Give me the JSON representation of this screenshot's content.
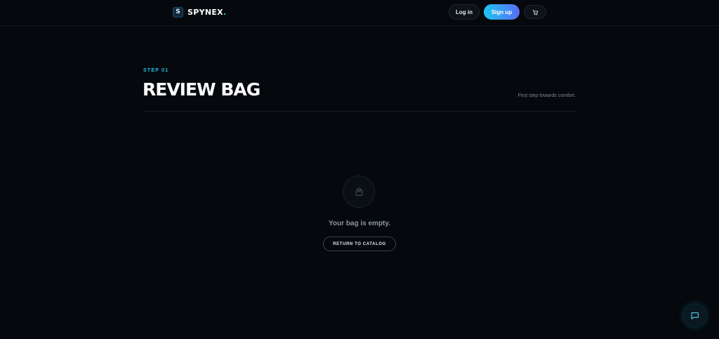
{
  "header": {
    "logo_mark": "S",
    "logo_name": "SPYNEX",
    "logo_dot": ".",
    "login_label": "Log in",
    "signup_label": "Sign up",
    "cart_icon": "cart-icon"
  },
  "main": {
    "step_label": "STEP 01",
    "title": "REVIEW BAG",
    "subtitle": "First step towards comfort.",
    "empty_icon": "bag-icon",
    "empty_message": "Your bag is empty.",
    "return_label": "RETURN TO CATALOG"
  },
  "chat": {
    "icon": "chat-icon"
  },
  "colors": {
    "background": "#05080c",
    "accent": "#22c5ee",
    "signup_gradient_start": "#1cc6f2",
    "signup_gradient_end": "#5a6cf5"
  }
}
